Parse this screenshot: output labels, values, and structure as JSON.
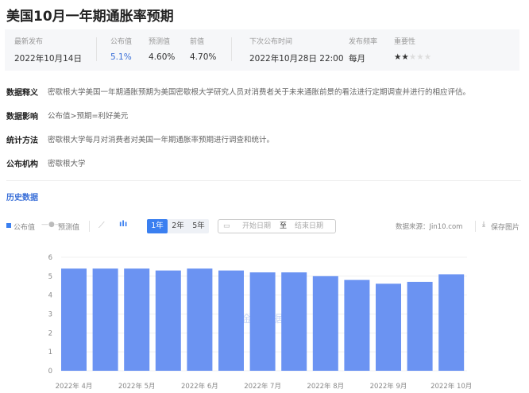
{
  "title": "美国10月一年期通胀率预期",
  "summary": {
    "latest_label": "最新发布",
    "latest_value": "2022年10月14日",
    "actual_label": "公布值",
    "actual_value": "5.1%",
    "forecast_label": "预测值",
    "forecast_value": "4.60%",
    "previous_label": "前值",
    "previous_value": "4.70%",
    "next_label": "下次公布时间",
    "next_value": "2022年10月28日 22:00",
    "freq_label": "发布频率",
    "freq_value": "每月",
    "importance_label": "重要性",
    "importance_stars": 2,
    "importance_max": 5
  },
  "info": [
    {
      "k": "数据释义",
      "v": "密歇根大学美国一年期通胀预期为美国密歇根大学研究人员对消费者关于未来通胀前景的看法进行定期调查并进行的相应评估。"
    },
    {
      "k": "数据影响",
      "v": "公布值>预期=利好美元"
    },
    {
      "k": "统计方法",
      "v": "密歇根大学每月对消费者对美国一年期通胀率预期进行调查和统计。"
    },
    {
      "k": "公布机构",
      "v": "密歇根大学"
    }
  ],
  "history_label": "历史数据",
  "toolbar": {
    "legend_actual": "公布值",
    "legend_forecast": "预测值",
    "ranges": [
      "1年",
      "2年",
      "5年"
    ],
    "active_range": "1年",
    "start_placeholder": "开始日期",
    "to": "至",
    "end_placeholder": "结束日期",
    "source": "数据来源：Jin10.com",
    "save": "保存图片"
  },
  "colors": {
    "bar": "#6b93f2",
    "accent": "#3a7ff0",
    "star": "#f5a623"
  },
  "chart_data": {
    "type": "bar",
    "categories": [
      "2022-04",
      "2022-04b",
      "2022-05",
      "2022-05b",
      "2022-06",
      "2022-06b",
      "2022-07",
      "2022-07b",
      "2022-08",
      "2022-08b",
      "2022-09",
      "2022-09b",
      "2022-10"
    ],
    "values": [
      5.4,
      5.4,
      5.4,
      5.3,
      5.4,
      5.3,
      5.2,
      5.2,
      5.0,
      4.8,
      4.6,
      4.7,
      5.1
    ],
    "xtick_labels": [
      "2022年 4月",
      "2022年 5月",
      "2022年 6月",
      "2022年 7月",
      "2022年 8月",
      "2022年 9月",
      "2022年 10月"
    ],
    "yticks": [
      0,
      1,
      2,
      3,
      4,
      5,
      6
    ],
    "ylim": [
      0,
      6
    ],
    "grid": true
  },
  "watermark": "金十数据"
}
